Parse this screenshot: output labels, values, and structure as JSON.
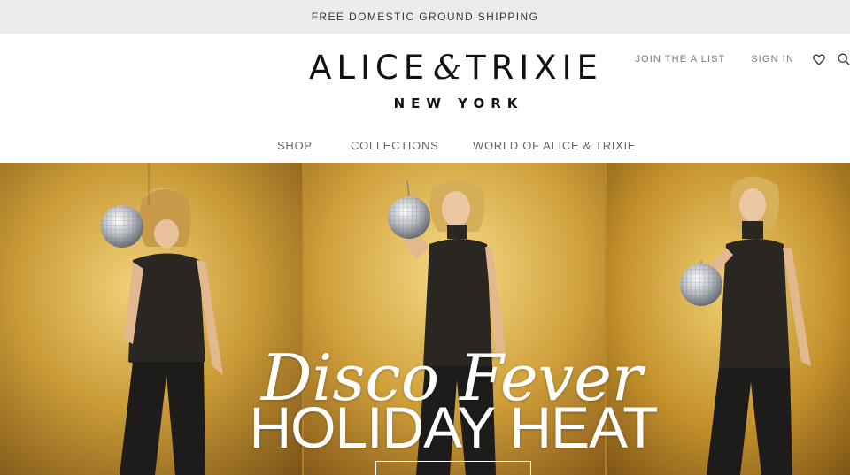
{
  "promo": {
    "text": "FREE DOMESTIC GROUND SHIPPING"
  },
  "header": {
    "logo": {
      "word1": "ALICE",
      "amp": "&",
      "word2": "TRIXIE",
      "subline": "NEW YORK"
    },
    "utility": {
      "join": "JOIN THE A LIST",
      "sign_in": "SIGN IN",
      "wishlist_icon": "heart-icon",
      "search_icon": "search-icon"
    }
  },
  "nav": {
    "items": [
      {
        "label": "SHOP"
      },
      {
        "label": "COLLECTIONS"
      },
      {
        "label": "WORLD OF ALICE & TRIXIE"
      }
    ]
  },
  "hero": {
    "script_title": "Disco Fever",
    "title": "HOLIDAY HEAT",
    "cta": ""
  },
  "colors": {
    "promo_bg": "#ececec",
    "gold": "#c79a2c",
    "text_dark": "#111111",
    "nav_text": "#666666"
  }
}
